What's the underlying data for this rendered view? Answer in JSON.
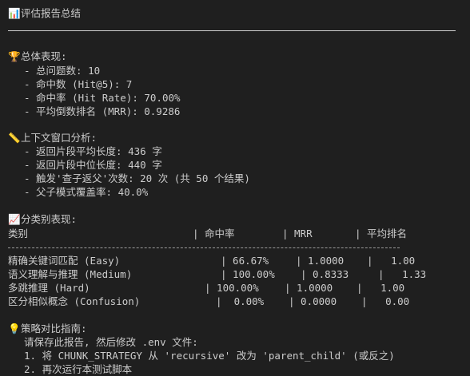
{
  "header": {
    "icon": "bar-chart-icon",
    "title": "评估报告总结"
  },
  "overall": {
    "icon": "trophy-icon",
    "title": "总体表现:",
    "items": [
      "- 总问题数: 10",
      "- 命中数 (Hit@5): 7",
      "- 命中率 (Hit Rate): 70.00%",
      "- 平均倒数排名 (MRR): 0.9286"
    ]
  },
  "context": {
    "icon": "ruler-icon",
    "title": "上下文窗口分析:",
    "items": [
      "- 返回片段平均长度: 436 字",
      "- 返回片段中位长度: 440 字",
      "- 触发'查子返父'次数: 20 次 (共 50 个结果)",
      "- 父子模式覆盖率: 40.0%"
    ]
  },
  "category": {
    "icon": "chart-up-icon",
    "title": "分类别表现:",
    "headers": [
      "类别",
      "| 命中率",
      "| MRR",
      "| 平均排名"
    ],
    "rows": [
      [
        "精确关键词匹配 (Easy)",
        "| 66.67%",
        "| 1.0000",
        "|   1.00"
      ],
      [
        "语义理解与推理 (Medium)",
        "| 100.00%",
        "| 0.8333",
        "|   1.33"
      ],
      [
        "多跳推理 (Hard)",
        "| 100.00%",
        "| 1.0000",
        "|   1.00"
      ],
      [
        "区分相似概念 (Confusion)",
        "|  0.00%",
        "| 0.0000",
        "|   0.00"
      ]
    ]
  },
  "guide": {
    "icon": "lightbulb-icon",
    "title": "策略对比指南:",
    "items": [
      "请保存此报告, 然后修改 .env 文件:",
      "1. 将 CHUNK_STRATEGY 从 'recursive' 改为 'parent_child' (或反之)",
      "2. 再次运行本测试脚本"
    ]
  }
}
